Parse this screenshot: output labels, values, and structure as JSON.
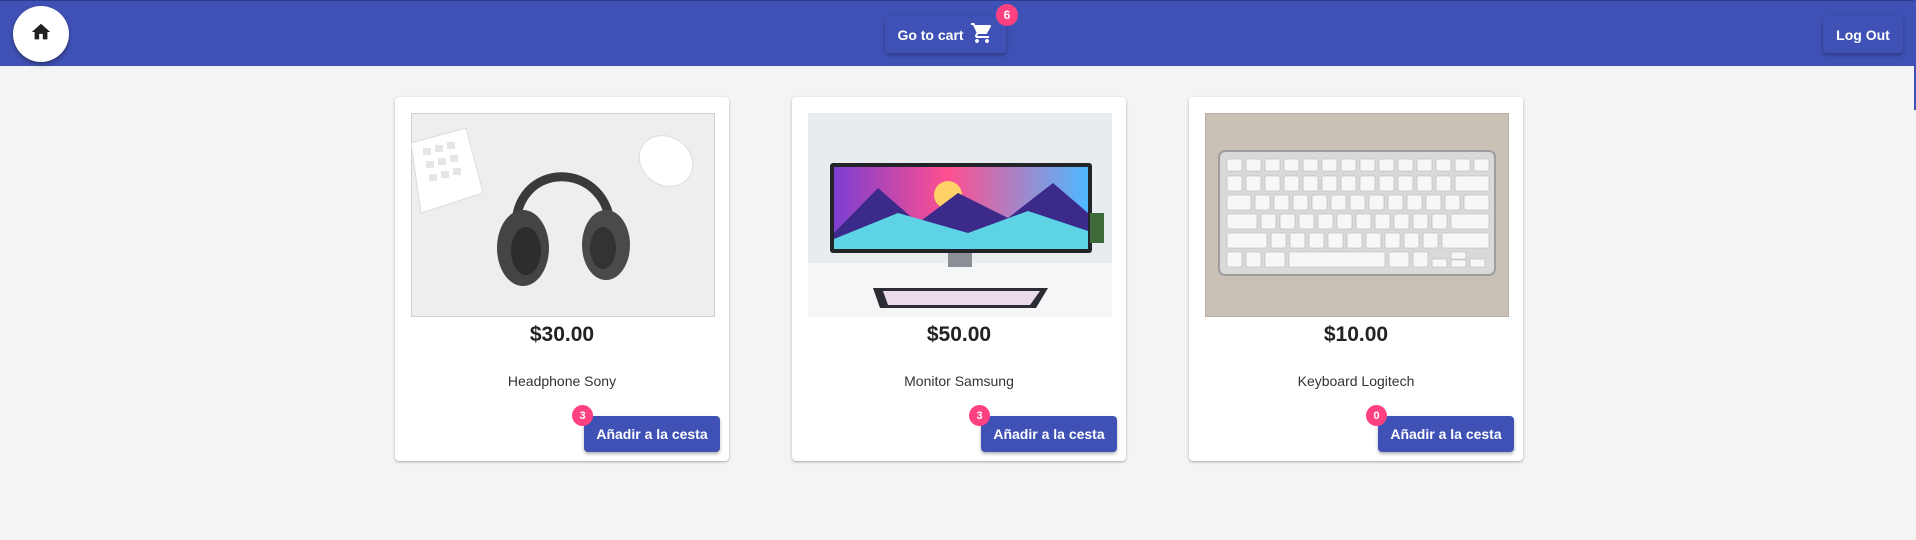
{
  "header": {
    "cart_label": "Go to cart",
    "cart_count": "6",
    "logout_label": "Log Out",
    "home_icon": "home-icon",
    "cart_icon": "shopping-cart-icon"
  },
  "colors": {
    "primary": "#3f51b5",
    "accent": "#ff4081",
    "background": "#f4f4f4"
  },
  "products": [
    {
      "price": "$30.00",
      "name": "Headphone Sony",
      "button_label": "Añadir a la cesta",
      "count": "3"
    },
    {
      "price": "$50.00",
      "name": "Monitor Samsung",
      "button_label": "Añadir a la cesta",
      "count": "3"
    },
    {
      "price": "$10.00",
      "name": "Keyboard Logitech",
      "button_label": "Añadir a la cesta",
      "count": "0"
    }
  ]
}
